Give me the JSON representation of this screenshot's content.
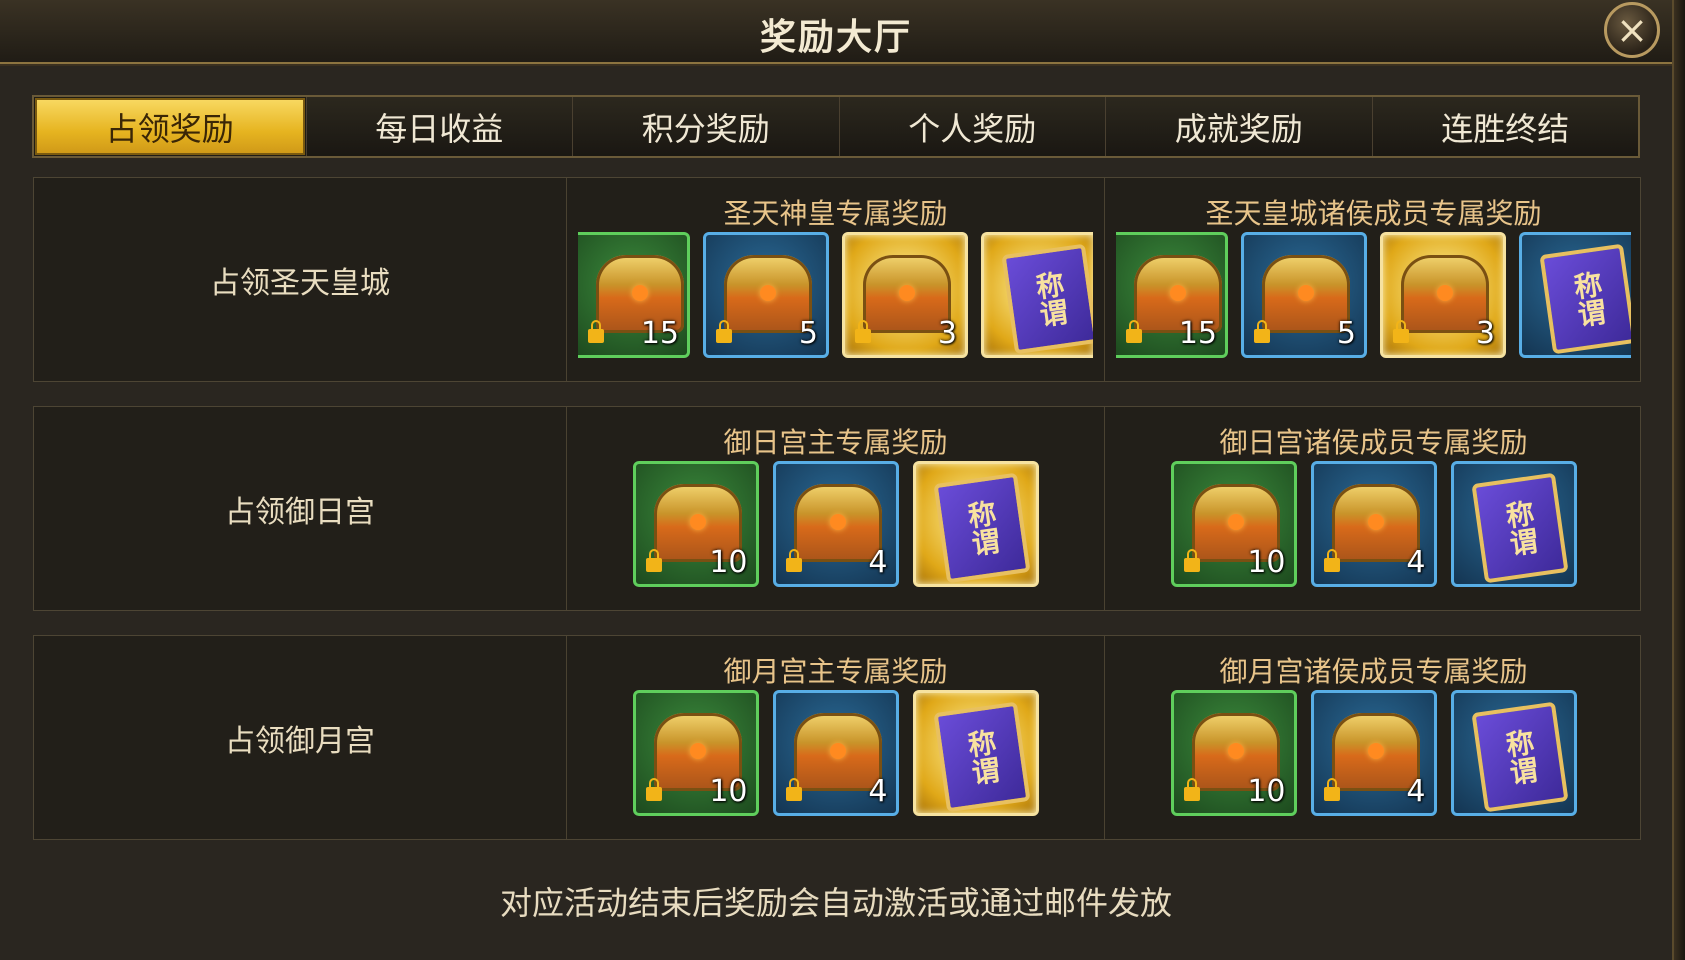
{
  "window": {
    "title": "奖励大厅",
    "close_icon": "close-icon"
  },
  "tabs": [
    {
      "label": "占领奖励",
      "active": true
    },
    {
      "label": "每日收益",
      "active": false
    },
    {
      "label": "积分奖励",
      "active": false
    },
    {
      "label": "个人奖励",
      "active": false
    },
    {
      "label": "成就奖励",
      "active": false
    },
    {
      "label": "连胜终结",
      "active": false
    }
  ],
  "rows": [
    {
      "label": "占领圣天皇城",
      "groups": [
        {
          "title": "圣天神皇专属奖励",
          "items": [
            {
              "type": "chest",
              "rarity": "green",
              "locked": true,
              "count": "15"
            },
            {
              "type": "chest",
              "rarity": "blue",
              "locked": true,
              "count": "5"
            },
            {
              "type": "chest",
              "rarity": "gold",
              "locked": true,
              "count": "3"
            },
            {
              "type": "scroll",
              "rarity": "gold",
              "text": "称谓"
            }
          ]
        },
        {
          "title": "圣天皇城诸侯成员专属奖励",
          "items": [
            {
              "type": "chest",
              "rarity": "green",
              "locked": true,
              "count": "15"
            },
            {
              "type": "chest",
              "rarity": "blue",
              "locked": true,
              "count": "5"
            },
            {
              "type": "chest",
              "rarity": "gold",
              "locked": true,
              "count": "3"
            },
            {
              "type": "scroll",
              "rarity": "blue",
              "text": "称谓"
            }
          ]
        }
      ]
    },
    {
      "label": "占领御日宫",
      "groups": [
        {
          "title": "御日宫主专属奖励",
          "items": [
            {
              "type": "chest",
              "rarity": "green",
              "locked": true,
              "count": "10"
            },
            {
              "type": "chest",
              "rarity": "blue",
              "locked": true,
              "count": "4"
            },
            {
              "type": "scroll",
              "rarity": "gold",
              "text": "称谓"
            }
          ]
        },
        {
          "title": "御日宫诸侯成员专属奖励",
          "items": [
            {
              "type": "chest",
              "rarity": "green",
              "locked": true,
              "count": "10"
            },
            {
              "type": "chest",
              "rarity": "blue",
              "locked": true,
              "count": "4"
            },
            {
              "type": "scroll",
              "rarity": "blue",
              "text": "称谓"
            }
          ]
        }
      ]
    },
    {
      "label": "占领御月宫",
      "groups": [
        {
          "title": "御月宫主专属奖励",
          "items": [
            {
              "type": "chest",
              "rarity": "green",
              "locked": true,
              "count": "10"
            },
            {
              "type": "chest",
              "rarity": "blue",
              "locked": true,
              "count": "4"
            },
            {
              "type": "scroll",
              "rarity": "gold",
              "text": "称谓"
            }
          ]
        },
        {
          "title": "御月宫诸侯成员专属奖励",
          "items": [
            {
              "type": "chest",
              "rarity": "green",
              "locked": true,
              "count": "10"
            },
            {
              "type": "chest",
              "rarity": "blue",
              "locked": true,
              "count": "4"
            },
            {
              "type": "scroll",
              "rarity": "blue",
              "text": "称谓"
            }
          ]
        }
      ]
    }
  ],
  "footer": "对应活动结束后奖励会自动激活或通过邮件发放",
  "colors": {
    "accent_gold": "#e6b420",
    "heading": "#e8c48a",
    "green_rarity": "#5fce5c",
    "blue_rarity": "#58aee6"
  }
}
